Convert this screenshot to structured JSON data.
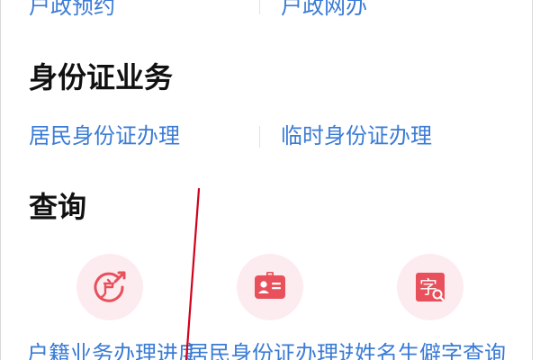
{
  "top_row": {
    "left_link": "户政预约",
    "right_link": "户政网办"
  },
  "id_section": {
    "title": "身份证业务",
    "left_link": "居民身份证办理",
    "right_link": "临时身份证办理"
  },
  "query_section": {
    "title": "查询",
    "items": [
      {
        "label": "户籍业务办理进度查询",
        "icon": "household-progress-icon"
      },
      {
        "label": "居民身份证办理进度查询",
        "icon": "id-card-icon"
      },
      {
        "label": "姓名生僻字查询",
        "icon": "rare-character-search-icon",
        "glyph": "字"
      }
    ]
  },
  "colors": {
    "link": "#3a7bd5",
    "heading": "#111111",
    "icon_bg": "#fdecef",
    "icon_red": "#e8505b",
    "annotation": "#d0021b"
  }
}
